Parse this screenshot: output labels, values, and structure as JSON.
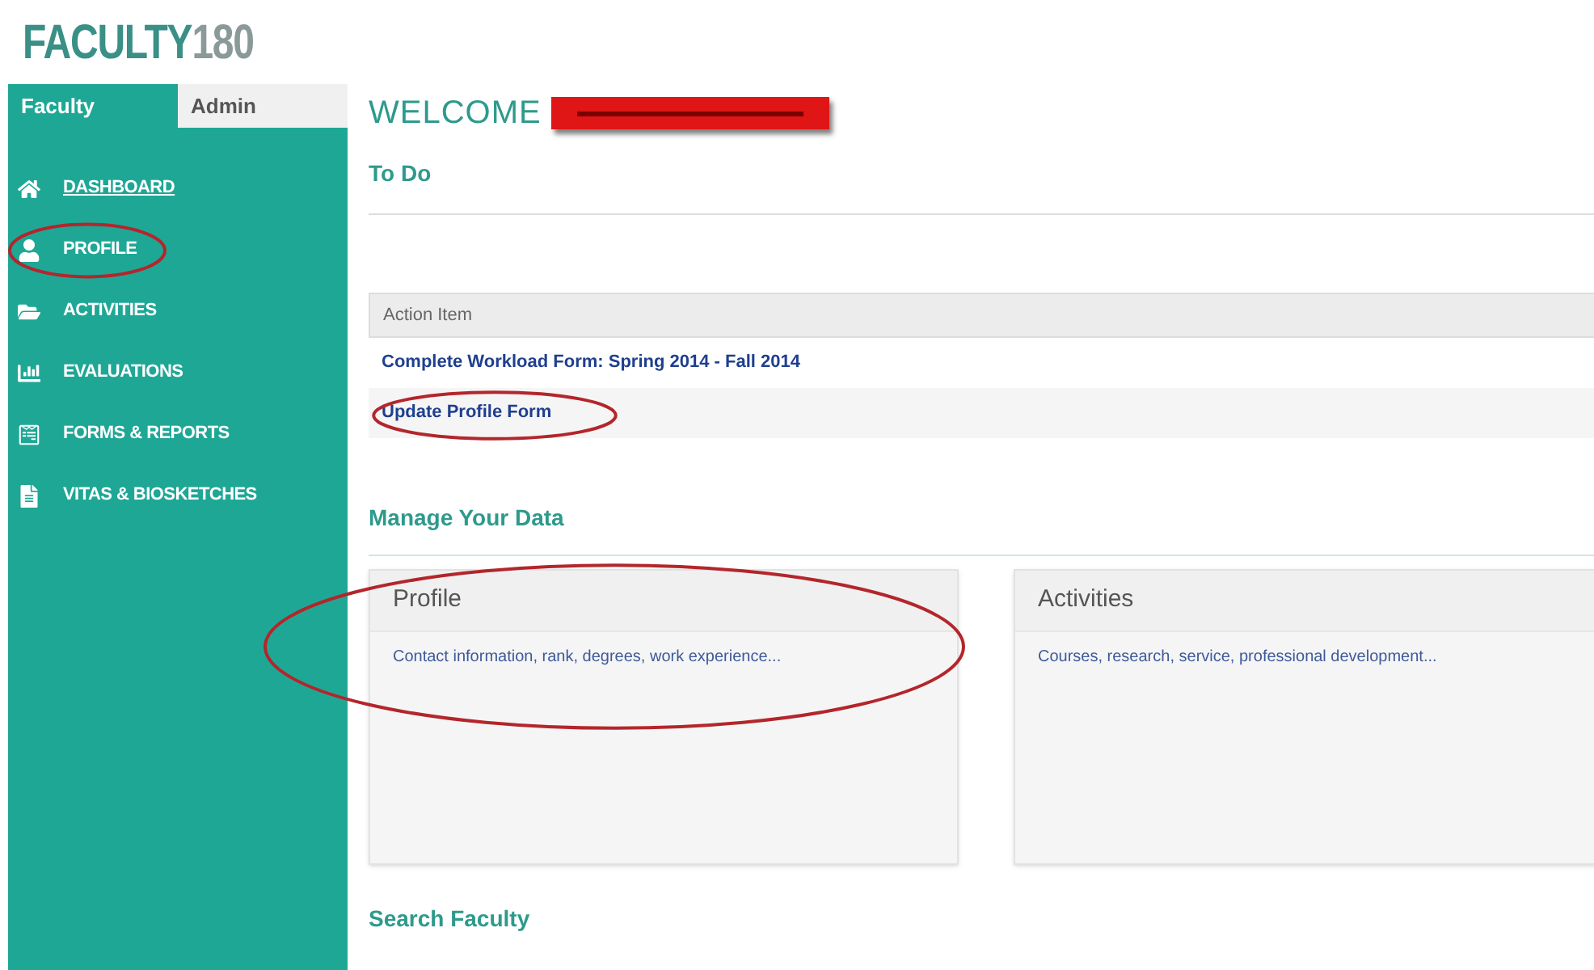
{
  "logo": {
    "brand": "FACULTY",
    "number": "180"
  },
  "tabs": [
    {
      "label": "Faculty",
      "selected": true
    },
    {
      "label": "Admin",
      "selected": false
    }
  ],
  "nav": [
    {
      "label": "DASHBOARD",
      "underlined": true
    },
    {
      "label": "PROFILE",
      "underlined": false
    },
    {
      "label": "ACTIVITIES",
      "underlined": false
    },
    {
      "label": "EVALUATIONS",
      "underlined": false
    },
    {
      "label": "FORMS & REPORTS",
      "underlined": false
    },
    {
      "label": "VITAS & BIOSKETCHES",
      "underlined": false
    }
  ],
  "welcome": "WELCOME",
  "todo": {
    "title": "To Do",
    "column": "Action Item",
    "items": [
      "Complete Workload Form: Spring 2014 - Fall 2014",
      "Update Profile Form"
    ]
  },
  "manage": {
    "title": "Manage Your Data",
    "cards": [
      {
        "title": "Profile",
        "description": "Contact information, rank, degrees, work experience..."
      },
      {
        "title": "Activities",
        "description": "Courses, research, service, professional development..."
      }
    ]
  },
  "search_title": "Search Faculty"
}
